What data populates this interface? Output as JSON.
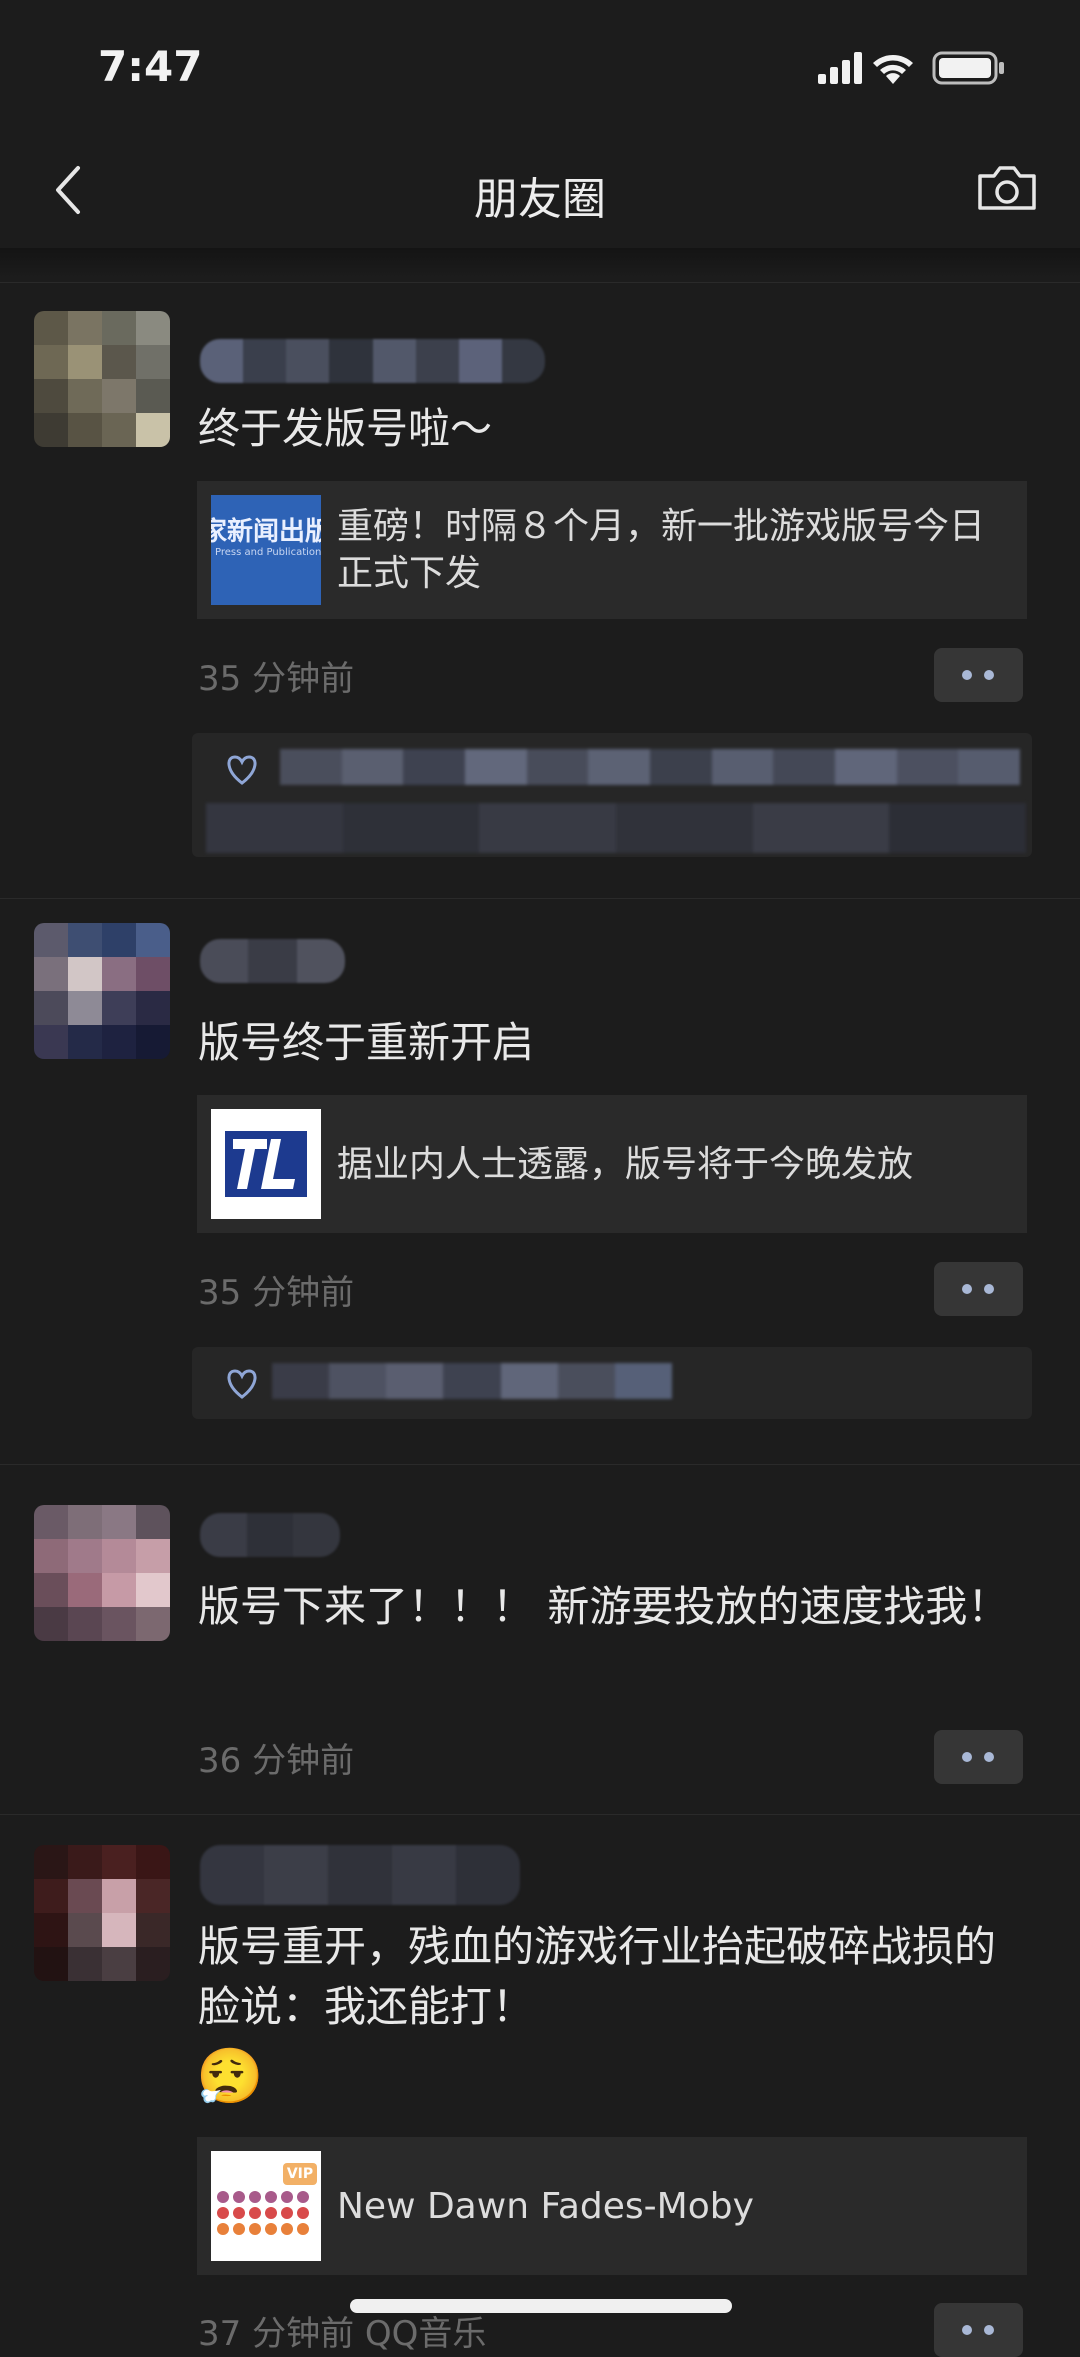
{
  "status_bar": {
    "time": "7:47"
  },
  "nav": {
    "title": "朋友圈"
  },
  "posts": [
    {
      "text": "终于发版号啦～",
      "link": {
        "title": "重磅！时隔８个月，新一批游戏版号今日正式下发",
        "thumb_text": "家新闻出版",
        "thumb_sub": "Press and Publication A"
      },
      "time": "35 分钟前"
    },
    {
      "text": "版号终于重新开启",
      "link": {
        "title": "据业内人士透露，版号将于今晚发放",
        "thumb_text": "TL"
      },
      "time": "35 分钟前"
    },
    {
      "text": "版号下来了！！！ 新游要投放的速度找我！",
      "time": "36 分钟前"
    },
    {
      "text": "版号重开，残血的游戏行业抬起破碎战损的脸说：我还能打！",
      "emoji": "😮‍💨",
      "link": {
        "title": "New Dawn Fades-Moby",
        "thumb_badge": "VIP"
      },
      "time": "37 分钟前",
      "source": "QQ音乐"
    }
  ]
}
